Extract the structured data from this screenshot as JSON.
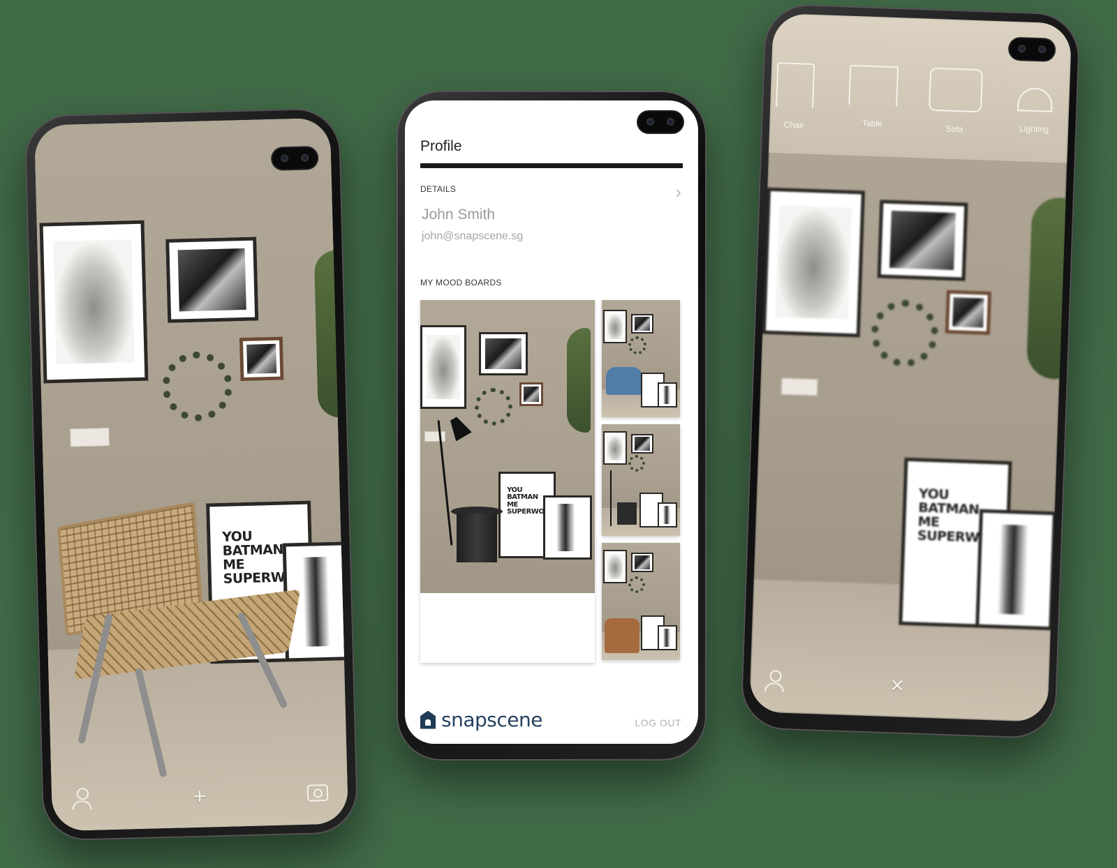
{
  "left_phone": {
    "poster_lines": [
      "YOU",
      "BATMAN",
      "ME",
      "SUPERWOM"
    ],
    "bottom_bar": {
      "profile_icon": "user-icon",
      "add_glyph": "+",
      "camera_icon": "camera-icon"
    }
  },
  "profile_phone": {
    "title": "Profile",
    "details_label": "DETAILS",
    "chevron": "›",
    "user": {
      "name": "John Smith",
      "email": "john@snapscene.sg"
    },
    "mood_boards_label": "MY MOOD BOARDS",
    "mini_poster_lines": [
      "YOU",
      "BATMAN",
      "ME",
      "SUPERWOM"
    ],
    "brand": "snapscene",
    "logout_label": "LOG OUT",
    "colors": {
      "brand": "#24415f",
      "rule": "#1a1a1a"
    }
  },
  "right_phone": {
    "categories": [
      {
        "label": "Chair",
        "icon": "chair-icon"
      },
      {
        "label": "Table",
        "icon": "table-icon"
      },
      {
        "label": "Sofa",
        "icon": "sofa-icon"
      },
      {
        "label": "Lighting",
        "icon": "lamp-icon"
      }
    ],
    "poster_lines": [
      "YOU",
      "BATMAN",
      "ME",
      "SUPERWOM"
    ],
    "bottom_bar": {
      "profile_icon": "user-icon",
      "close_glyph": "✕"
    }
  },
  "background_color": "#416a47"
}
